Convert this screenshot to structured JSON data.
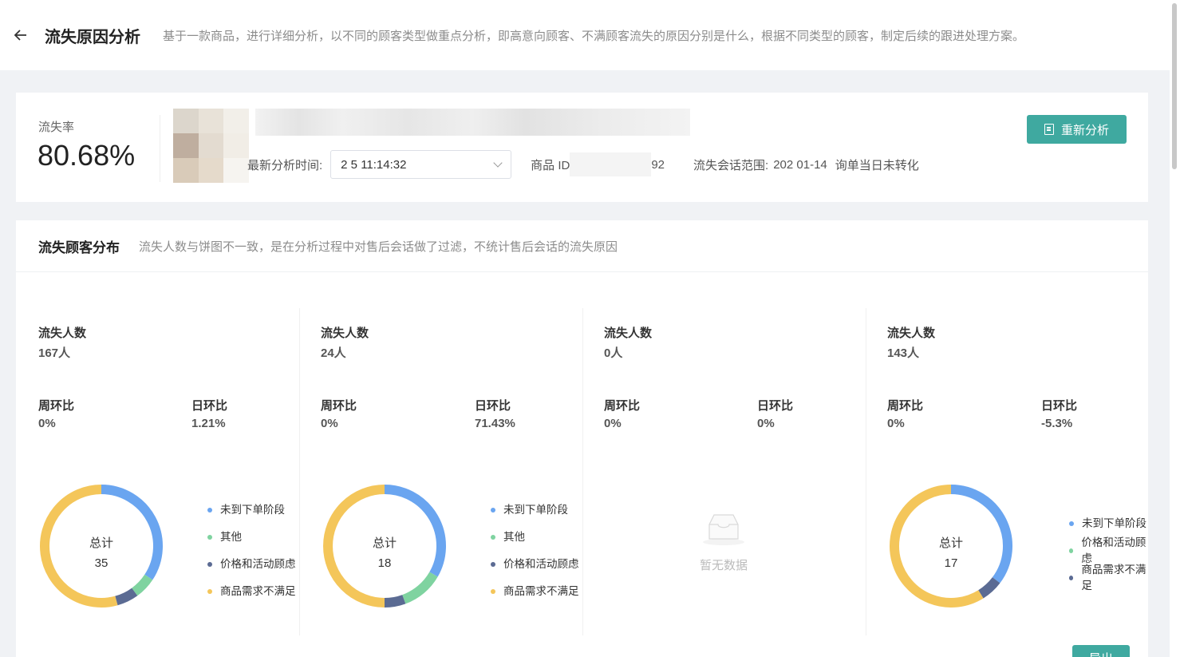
{
  "header": {
    "title": "流失原因分析",
    "description": "基于一款商品，进行详细分析，以不同的顾客类型做重点分析，即高意向顾客、不满顾客流失的原因分别是什么，根据不同类型的顾客，制定后续的跟进处理方案。"
  },
  "summary": {
    "rate_label": "流失率",
    "rate_value": "80.68%",
    "analysis_time_label": "最新分析时间:",
    "analysis_time_value": "2          5 11:14:32",
    "goods_id_label": "商品 ID",
    "goods_id_value": "92",
    "range_label": "流失会话范围:",
    "range_value": "202    01-14",
    "range_note": "询单当日未转化",
    "reanalyze_label": "重新分析"
  },
  "distribution": {
    "title": "流失顾客分布",
    "description": "流失人数与饼图不一致，是在分析过程中对售后会话做了过滤，不统计售后会话的流失原因",
    "columns": [
      {
        "count_label": "流失人数",
        "count_value": "167人",
        "week_label": "周环比",
        "week_value": "0%",
        "day_label": "日环比",
        "day_value": "1.21%",
        "total_label": "总计",
        "total_value": "35",
        "legend": [
          "未到下单阶段",
          "其他",
          "价格和活动顾虑",
          "商品需求不满足"
        ]
      },
      {
        "count_label": "流失人数",
        "count_value": "24人",
        "week_label": "周环比",
        "week_value": "0%",
        "day_label": "日环比",
        "day_value": "71.43%",
        "total_label": "总计",
        "total_value": "18",
        "legend": [
          "未到下单阶段",
          "其他",
          "价格和活动顾虑",
          "商品需求不满足"
        ]
      },
      {
        "count_label": "流失人数",
        "count_value": "0人",
        "week_label": "周环比",
        "week_value": "0%",
        "day_label": "日环比",
        "day_value": "0%",
        "empty_text": "暂无数据"
      },
      {
        "count_label": "流失人数",
        "count_value": "143人",
        "week_label": "周环比",
        "week_value": "0%",
        "day_label": "日环比",
        "day_value": "-5.3%",
        "total_label": "总计",
        "total_value": "17",
        "legend": [
          "未到下单阶段",
          "价格和活动顾虑",
          "商品需求不满足"
        ]
      }
    ],
    "export_label": "导出"
  },
  "colors": {
    "blue": "#6aa5f0",
    "green": "#7fd3a0",
    "navy": "#5b6b93",
    "yellow": "#f4c65a",
    "accent": "#3fa9a0"
  },
  "chart_data": [
    {
      "type": "pie",
      "total": 35,
      "categories": [
        "未到下单阶段",
        "其他",
        "价格和活动顾虑",
        "商品需求不满足"
      ],
      "values": [
        12,
        2,
        2,
        19
      ]
    },
    {
      "type": "pie",
      "total": 18,
      "categories": [
        "未到下单阶段",
        "其他",
        "价格和活动顾虑",
        "商品需求不满足"
      ],
      "values": [
        6,
        2,
        1,
        9
      ]
    },
    {
      "type": "pie",
      "total": 17,
      "categories": [
        "未到下单阶段",
        "价格和活动顾虑",
        "商品需求不满足"
      ],
      "values": [
        6,
        1,
        10
      ]
    }
  ]
}
